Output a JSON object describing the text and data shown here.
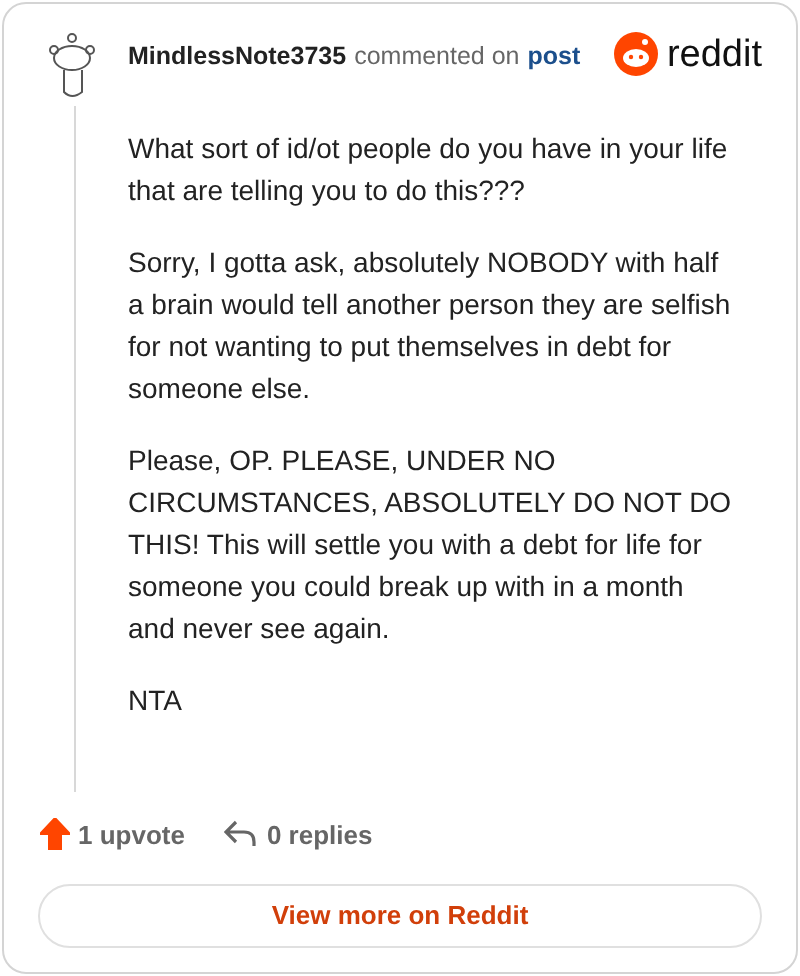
{
  "comment": {
    "author": "MindlessNote3735",
    "action": "commented on",
    "link": "post",
    "brand": "reddit",
    "paragraphs": [
      "What sort of id/ot people do you have in your life that are telling you to do this???",
      "Sorry, I gotta ask, absolutely NOBODY with half a brain would tell another person they are selfish for not wanting to put themselves in debt for someone else.",
      "Please, OP. PLEASE, UNDER NO CIRCUMSTANCES, ABSOLUTELY DO NOT DO THIS! This will settle you with a debt for life for someone you could break up with in a month and never see again.",
      "NTA"
    ],
    "upvote": {
      "label": "1 upvote",
      "upvoted": true
    },
    "replies": {
      "label": "0 replies"
    },
    "button": "View more on Reddit"
  }
}
